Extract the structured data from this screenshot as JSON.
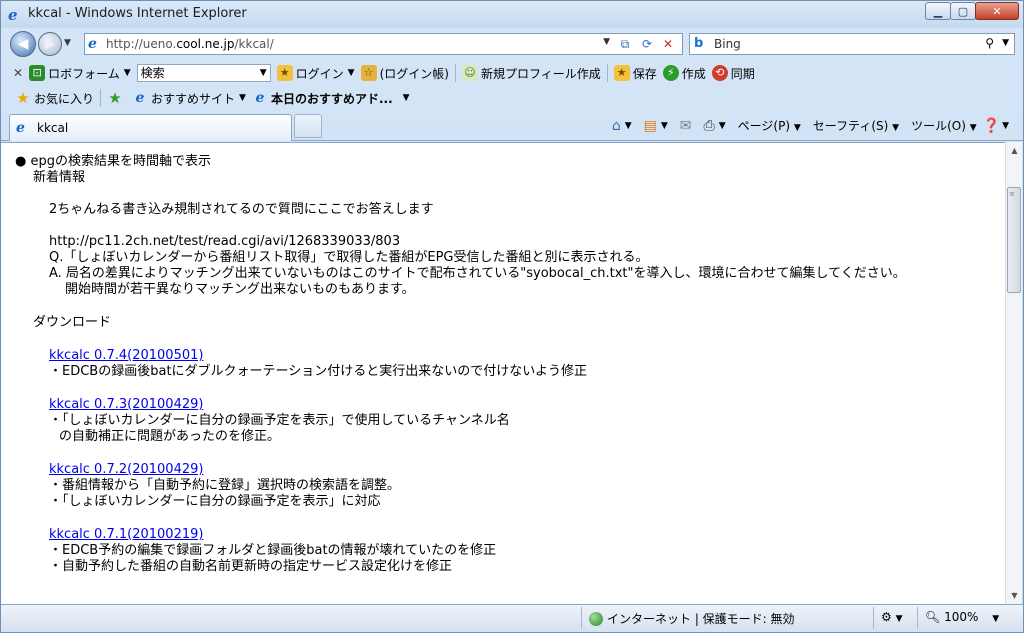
{
  "window": {
    "title": "kkcal - Windows Internet Explorer",
    "min_icon": "▁",
    "max_icon": "▢",
    "close_icon": "✕"
  },
  "address": {
    "url_prefix": "http://ueno.",
    "url_host": "cool.ne.jp",
    "url_suffix": "/kkcal/"
  },
  "search": {
    "engine_label": "Bing"
  },
  "toolbar1": {
    "close": "✕",
    "roboform": "ロボフォーム",
    "search_combo": "検索",
    "login": "ログイン",
    "login_history": "(ログイン帳)",
    "new_profile": "新規プロフィール作成",
    "save": "保存",
    "create": "作成",
    "sync": "同期"
  },
  "favorites": {
    "favorites_label": "お気に入り",
    "recommended_sites": "おすすめサイト",
    "todays_pick": "本日のおすすめアド..."
  },
  "tab": {
    "label": "kkcal"
  },
  "commandbar": {
    "page": "ページ(P)",
    "safety": "セーフティ(S)",
    "tools": "ツール(O)"
  },
  "content": {
    "heading": "● epgの検索結果を時間軸で表示",
    "news_label": "新着情報",
    "notice": "2ちゃんねる書き込み規制されてるので質問にここでお答えします",
    "thread_url": "http://pc11.2ch.net/test/read.cgi/avi/1268339033/803",
    "q_line": "Q.「しょぼいカレンダーから番組リスト取得」で取得した番組がEPG受信した番組と別に表示される。",
    "a_line1": "A. 局名の差異によりマッチング出来ていないものはこのサイトで配布されている\"syobocal_ch.txt\"を導入し、環境に合わせて編集してください。",
    "a_line2": "開始時間が若干異なりマッチング出来ないものもあります。",
    "download_label": "ダウンロード",
    "releases": [
      {
        "link": "kkcalc 0.7.4(20100501)",
        "notes": [
          "・EDCBの録画後batにダブルクォーテーション付けると実行出来ないので付けないよう修正"
        ]
      },
      {
        "link": "kkcalc 0.7.3(20100429)",
        "notes": [
          "・「しょぼいカレンダーに自分の録画予定を表示」で使用しているチャンネル名",
          "の自動補正に問題があったのを修正。"
        ]
      },
      {
        "link": "kkcalc 0.7.2(20100429)",
        "notes": [
          "・番組情報から「自動予約に登録」選択時の検索語を調整。",
          "・「しょぼいカレンダーに自分の録画予定を表示」に対応"
        ]
      },
      {
        "link": "kkcalc 0.7.1(20100219)",
        "notes": [
          "・EDCB予約の編集で録画フォルダと録画後batの情報が壊れていたのを修正",
          "・自動予約した番組の自動名前更新時の指定サービス設定化けを修正"
        ]
      }
    ]
  },
  "status": {
    "zone": "インターネット | 保護モード: 無効",
    "zoom": "100%"
  }
}
